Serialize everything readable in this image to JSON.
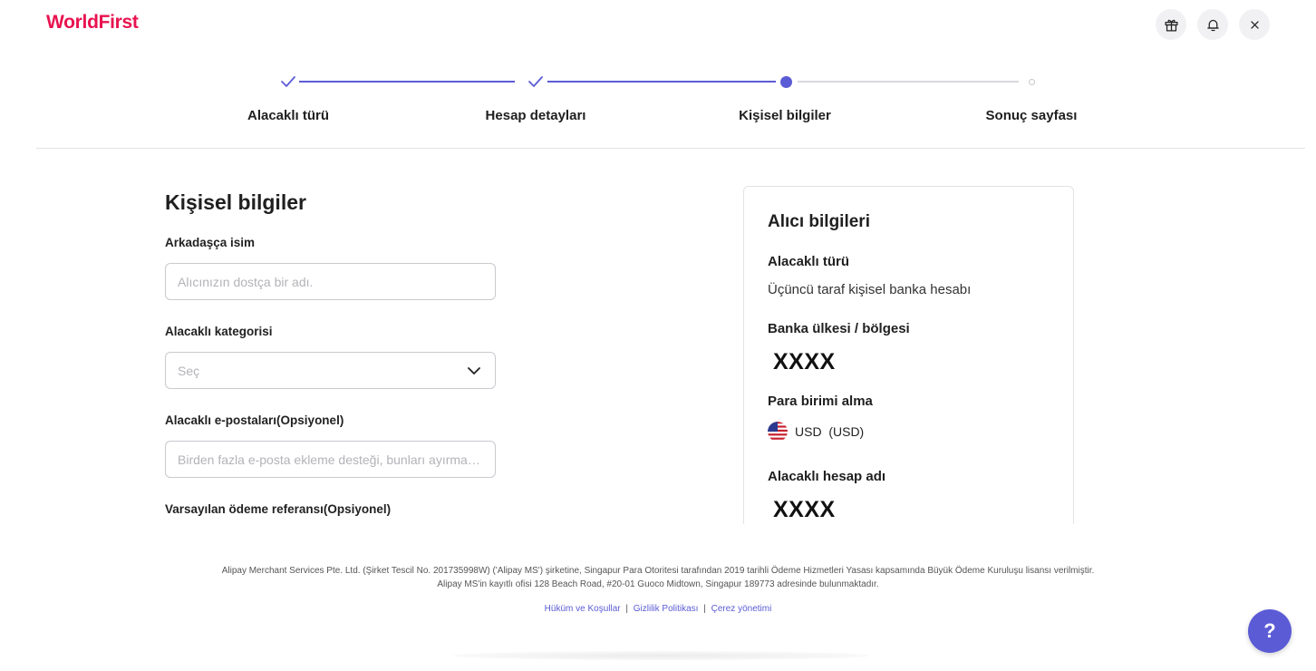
{
  "header": {
    "logo": "WorldFirst",
    "icons": [
      "gift-icon",
      "bell-icon",
      "close-icon"
    ]
  },
  "stepper": {
    "steps": [
      {
        "label": "Alacaklı türü",
        "status": "done"
      },
      {
        "label": "Hesap detayları",
        "status": "done"
      },
      {
        "label": "Kişisel bilgiler",
        "status": "active"
      },
      {
        "label": "Sonuç sayfası",
        "status": "todo"
      }
    ]
  },
  "form": {
    "title": "Kişisel bilgiler",
    "friendly_name": {
      "label": "Arkadaşça isim",
      "value": "",
      "placeholder": "Alıcınızın dostça bir adı."
    },
    "category": {
      "label": "Alacaklı kategorisi",
      "placeholder": "Seç"
    },
    "emails": {
      "label": "Alacaklı e-postaları(Opsiyonel)",
      "value": "",
      "placeholder": "Birden fazla e-posta ekleme desteği, bunları ayırma…"
    },
    "reference": {
      "label": "Varsayılan ödeme referansı(Opsiyonel)"
    }
  },
  "summary": {
    "title": "Alıcı bilgileri",
    "payee_type_label": "Alacaklı türü",
    "payee_type_value": "Üçüncü taraf kişisel banka hesabı",
    "bank_country_label": "Banka ülkesi / bölgesi",
    "bank_country_value": "XXXX",
    "currency_label": "Para birimi alma",
    "currency_value": "USD  (USD)",
    "account_name_label": "Alacaklı hesap adı",
    "account_name_value": "XXXX"
  },
  "footer": {
    "line1": "Alipay Merchant Services Pte. Ltd. (Şirket Tescil No. 201735998W) ('Alipay MS') şirketine, Singapur Para Otoritesi tarafından 2019 tarihli Ödeme Hizmetleri Yasası kapsamında Büyük Ödeme Kuruluşu lisansı verilmiştir.",
    "line2": "Alipay MS'in kayıtlı ofisi 128 Beach Road, #20-01 Guoco Midtown, Singapur 189773 adresinde bulunmaktadır.",
    "links": [
      "Hüküm ve Koşullar",
      "Gizlilik Politikası",
      "Çerez yönetimi"
    ],
    "separator": "|"
  },
  "help": {
    "label": "?"
  },
  "colors": {
    "brand": "#e8124f",
    "accent": "#5b5bd6"
  }
}
